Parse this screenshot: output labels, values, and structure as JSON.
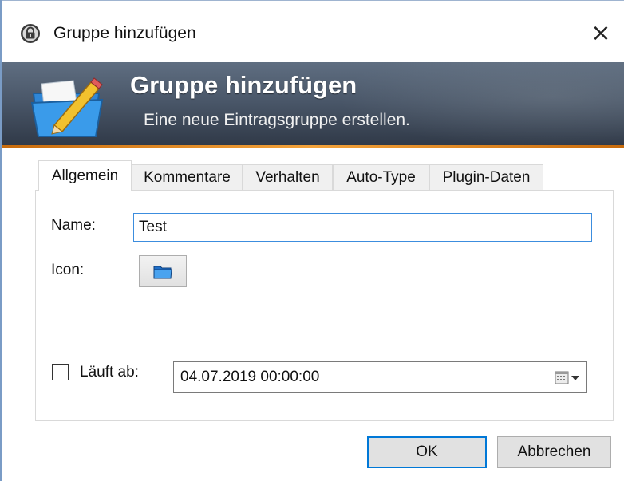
{
  "window": {
    "title": "Gruppe hinzufügen",
    "close_icon": "close-icon"
  },
  "banner": {
    "title": "Gruppe hinzufügen",
    "subtitle": "Eine neue Eintragsgruppe erstellen.",
    "icon": "folder-pencil-icon",
    "accent_color": "#f3a23a"
  },
  "tabs": [
    {
      "label": "Allgemein",
      "active": true
    },
    {
      "label": "Kommentare",
      "active": false
    },
    {
      "label": "Verhalten",
      "active": false
    },
    {
      "label": "Auto-Type",
      "active": false
    },
    {
      "label": "Plugin-Daten",
      "active": false
    }
  ],
  "general": {
    "name_label": "Name:",
    "name_value": "Test",
    "icon_label": "Icon:",
    "icon_button_icon": "folder-icon",
    "expires_label": "Läuft ab:",
    "expires_checked": false,
    "expires_value": "04.07.2019 00:00:00",
    "calendar_icon": "calendar-dropdown-icon"
  },
  "buttons": {
    "ok": "OK",
    "cancel": "Abbrechen"
  },
  "colors": {
    "focus_border": "#3c8dde",
    "default_button_border": "#0078d7"
  }
}
